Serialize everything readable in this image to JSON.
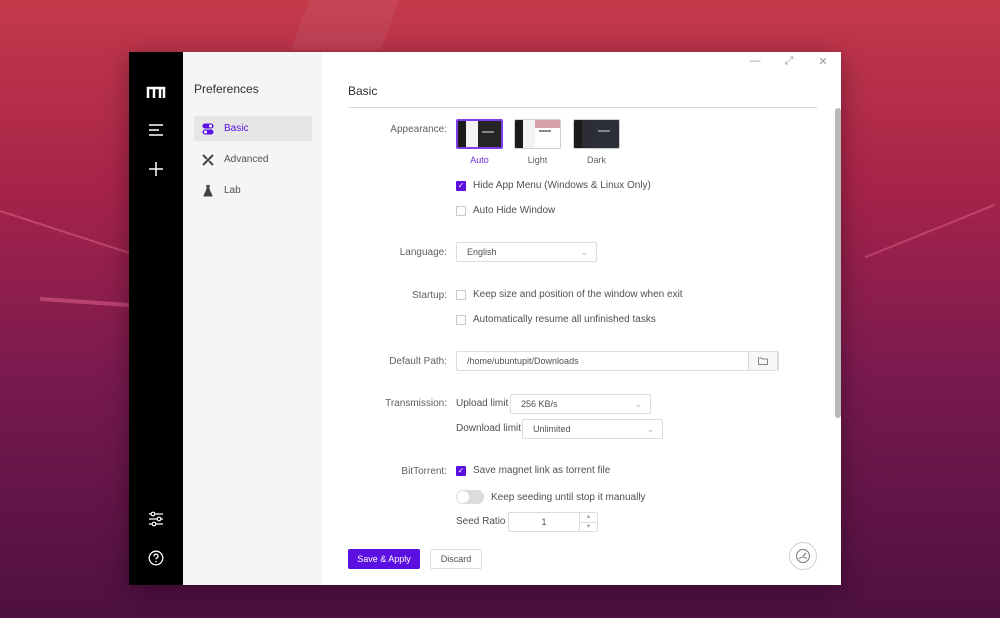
{
  "window_title": "Preferences",
  "sidebar": {
    "items": [
      {
        "label": "Basic",
        "icon": "toggle-icon",
        "active": true
      },
      {
        "label": "Advanced",
        "icon": "tools-icon",
        "active": false
      },
      {
        "label": "Lab",
        "icon": "flask-icon",
        "active": false
      }
    ]
  },
  "main": {
    "heading": "Basic",
    "appearance": {
      "label": "Appearance:",
      "themes": [
        {
          "label": "Auto",
          "selected": true
        },
        {
          "label": "Light",
          "selected": false
        },
        {
          "label": "Dark",
          "selected": false
        }
      ],
      "hide_app_menu": {
        "label": "Hide App Menu (Windows & Linux Only)",
        "checked": true
      },
      "auto_hide_window": {
        "label": "Auto Hide Window",
        "checked": false
      }
    },
    "language": {
      "label": "Language:",
      "value": "English"
    },
    "startup": {
      "label": "Startup:",
      "keep_size": {
        "label": "Keep size and position of the window when exit",
        "checked": false
      },
      "auto_resume": {
        "label": "Automatically resume all unfinished tasks",
        "checked": false
      }
    },
    "default_path": {
      "label": "Default Path:",
      "value": "/home/ubuntupit/Downloads"
    },
    "transmission": {
      "label": "Transmission:",
      "upload_label": "Upload limit",
      "upload_value": "256 KB/s",
      "download_label": "Download limit",
      "download_value": "Unlimited"
    },
    "bittorrent": {
      "label": "BitTorrent:",
      "save_magnet": {
        "label": "Save magnet link as torrent file",
        "checked": true
      },
      "keep_seeding": {
        "label": "Keep seeding until stop it manually",
        "on": false
      },
      "seed_ratio_label": "Seed Ratio",
      "seed_ratio_value": "1"
    },
    "buttons": {
      "save": "Save & Apply",
      "discard": "Discard"
    }
  },
  "colors": {
    "accent": "#5b0fe0",
    "rail": "#000000"
  }
}
